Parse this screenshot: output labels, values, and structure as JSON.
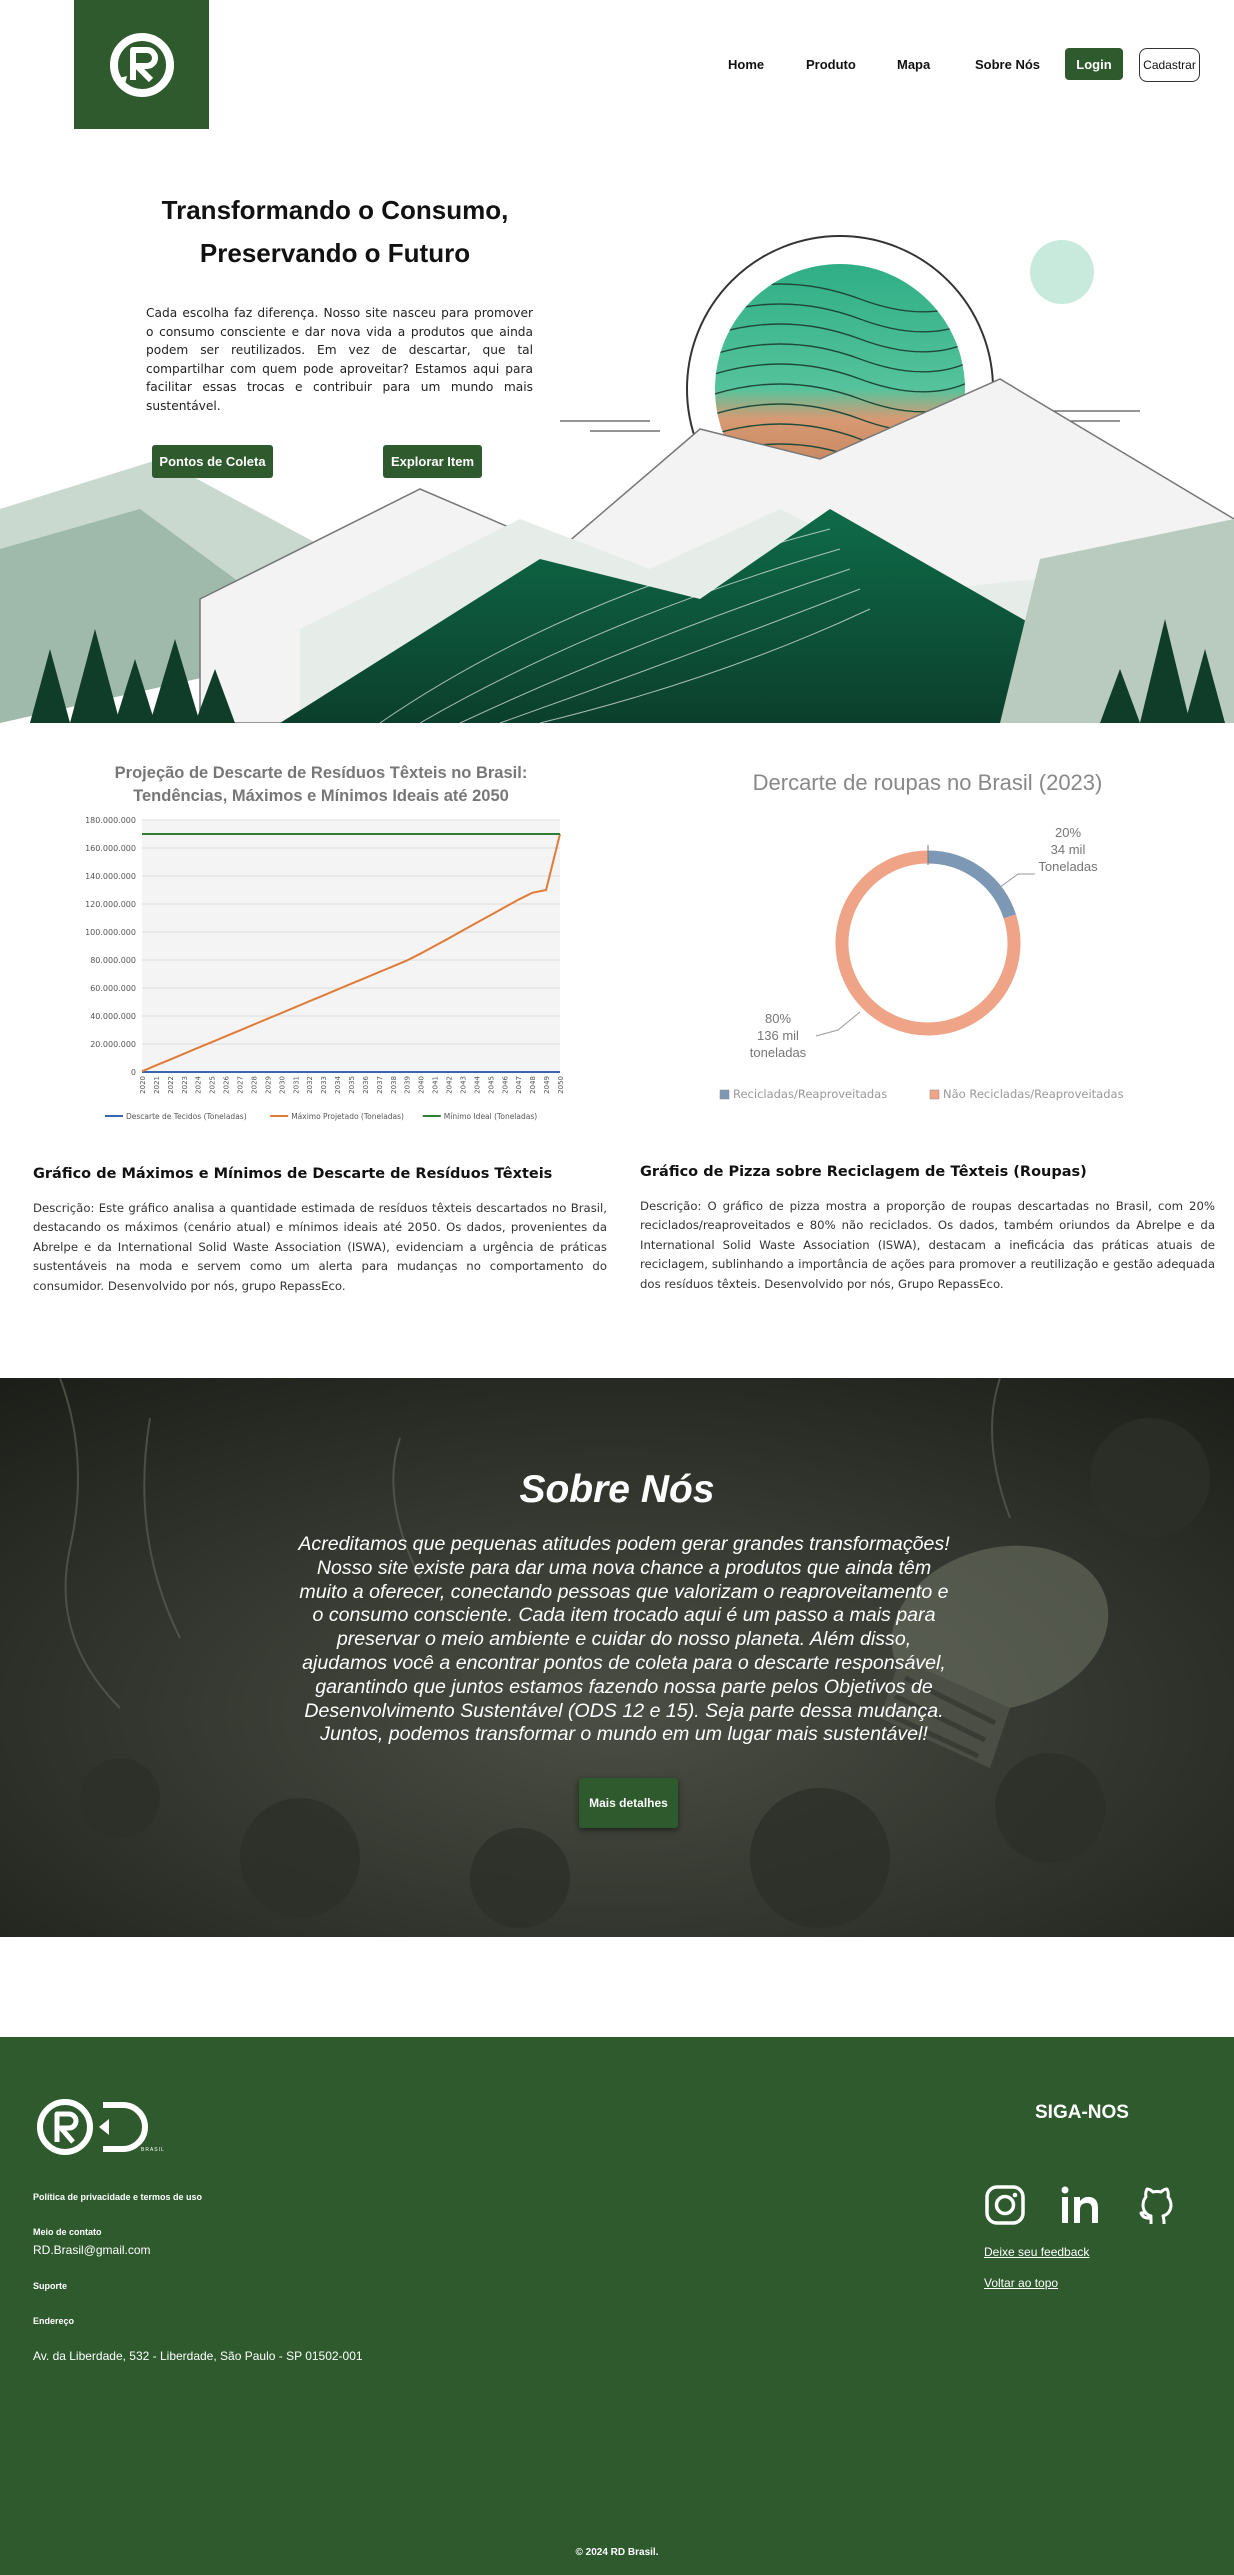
{
  "header": {
    "nav": [
      "Home",
      "Produto",
      "Mapa",
      "Sobre Nós"
    ],
    "login": "Login",
    "signup": "Cadastrar"
  },
  "hero": {
    "title_line1": "Transformando o Consumo,",
    "title_line2": "Preservando o Futuro",
    "text": "Cada escolha faz diferença. Nosso site nasceu para promover o consumo consciente e dar nova vida a produtos que ainda podem ser reutilizados. Em vez de descartar, que tal compartilhar com quem pode aproveitar? Estamos aqui para facilitar essas trocas e contribuir para um mundo mais sustentável.",
    "btn_collect": "Pontos de Coleta",
    "btn_explore": "Explorar Item"
  },
  "line_chart_section": {
    "heading": "Gráfico de Máximos e Mínimos de Descarte de Resíduos Têxteis",
    "description": "Descrição: Este gráfico analisa a quantidade estimada de resíduos têxteis descartados no Brasil, destacando os máximos (cenário atual) e mínimos ideais até 2050. Os dados, provenientes da Abrelpe e da International Solid Waste Association (ISWA), evidenciam a urgência de práticas sustentáveis na moda e servem como um alerta para mudanças no comportamento do consumidor. Desenvolvido por nós, grupo RepassEco."
  },
  "pie_chart_section": {
    "heading": "Gráfico de Pizza sobre Reciclagem de Têxteis (Roupas)",
    "description": "Descrição: O gráfico de pizza mostra a proporção de roupas descartadas no Brasil, com 20% reciclados/reaproveitados e 80% não reciclados. Os dados, também oriundos da Abrelpe e da International Solid Waste Association (ISWA), destacam a ineficácia das práticas atuais de reciclagem, sublinhando a importância de ações para promover a reutilização e gestão adequada dos resíduos têxteis. Desenvolvido por nós, Grupo RepassEco."
  },
  "chart_data": [
    {
      "type": "line",
      "title": "Projeção de Descarte de Resíduos Têxteis no Brasil: Tendências, Máximos e Mínimos Ideais até 2050",
      "x": [
        "2020",
        "2021",
        "2022",
        "2023",
        "2024",
        "2025",
        "2026",
        "2027",
        "2028",
        "2029",
        "2030",
        "2031",
        "2032",
        "2033",
        "2034",
        "2035",
        "2036",
        "2037",
        "2038",
        "2039",
        "2040",
        "2041",
        "2042",
        "2043",
        "2044",
        "2045",
        "2046",
        "2047",
        "2048",
        "2049",
        "2050"
      ],
      "y_ticks": [
        "0",
        "20.000.000",
        "40.000.000",
        "60.000.000",
        "80.000.000",
        "100.000.000",
        "120.000.000",
        "140.000.000",
        "160.000.000",
        "180.000.000"
      ],
      "ylim": [
        0,
        180000000
      ],
      "series": [
        {
          "name": "Descarte de Tecidos (Toneladas)",
          "color": "#3a66b0",
          "values": [
            0,
            0,
            0,
            0,
            0,
            0,
            0,
            0,
            0,
            0,
            0,
            0,
            0,
            0,
            0,
            0,
            0,
            0,
            0,
            0,
            0,
            0,
            0,
            0,
            0,
            0,
            0,
            0,
            0,
            0,
            0
          ]
        },
        {
          "name": "Máximo Projetado (Toneladas)",
          "color": "#e07b39",
          "values": [
            500000,
            4700000,
            8800000,
            13000000,
            17200000,
            21300000,
            25500000,
            29600000,
            33800000,
            38000000,
            42100000,
            46300000,
            50500000,
            54600000,
            58800000,
            63000000,
            67100000,
            71300000,
            75400000,
            79600000,
            84600000,
            90000000,
            95400000,
            101000000,
            106500000,
            112000000,
            117500000,
            123000000,
            128000000,
            130000000,
            170000000
          ]
        },
        {
          "name": "Mínimo Ideal (Toneladas)",
          "color": "#2e7d32",
          "values": [
            170000000,
            170000000,
            170000000,
            170000000,
            170000000,
            170000000,
            170000000,
            170000000,
            170000000,
            170000000,
            170000000,
            170000000,
            170000000,
            170000000,
            170000000,
            170000000,
            170000000,
            170000000,
            170000000,
            170000000,
            170000000,
            170000000,
            170000000,
            170000000,
            170000000,
            170000000,
            170000000,
            170000000,
            170000000,
            170000000,
            170000000
          ]
        }
      ],
      "grid": true,
      "legend": "bottom"
    },
    {
      "type": "pie",
      "title": "Dercarte de roupas no Brasil (2023)",
      "slices": [
        {
          "name": "Recicladas/Reaproveitadas",
          "value": 20,
          "color": "#7d98b5",
          "label_pct": "20%",
          "label_amount": "34 mil",
          "label_unit": "Toneladas"
        },
        {
          "name": "Não Recicladas/Reaproveitadas",
          "value": 80,
          "color": "#efa487",
          "label_pct": "80%",
          "label_amount": "136 mil",
          "label_unit": "toneladas"
        }
      ],
      "legend": "bottom"
    }
  ],
  "sobre": {
    "title": "Sobre Nós",
    "text": "Acreditamos que pequenas atitudes podem gerar grandes transformações! Nosso site existe para dar uma nova chance a produtos que ainda têm muito a oferecer, conectando pessoas que valorizam o reaproveitamento e o consumo consciente. Cada item trocado aqui é um passo a mais para preservar o meio ambiente e cuidar do nosso planeta. Além disso, ajudamos você a encontrar pontos de coleta para o descarte responsável, garantindo que juntos estamos fazendo nossa parte pelos Objetivos de Desenvolvimento Sustentável (ODS 12 e 15). Seja parte dessa mudança. Juntos, podemos transformar o mundo em um lugar mais sustentável!",
    "button": "Mais detalhes"
  },
  "footer": {
    "logo_sub": "BRASIL",
    "privacy": "Política de privacidade e termos de uso",
    "contact_label": "Meio de contato",
    "contact_value": "RD.Brasil@gmail.com",
    "support": "Suporte",
    "address_label": "Endereço",
    "address_value": "Av. da Liberdade, 532 - Liberdade, São Paulo - SP 01502-001",
    "follow": "SIGA-NOS",
    "feedback": "Deixe seu feedback",
    "back_top": "Voltar ao topo",
    "copyright": "© 2024 RD Brasil."
  }
}
